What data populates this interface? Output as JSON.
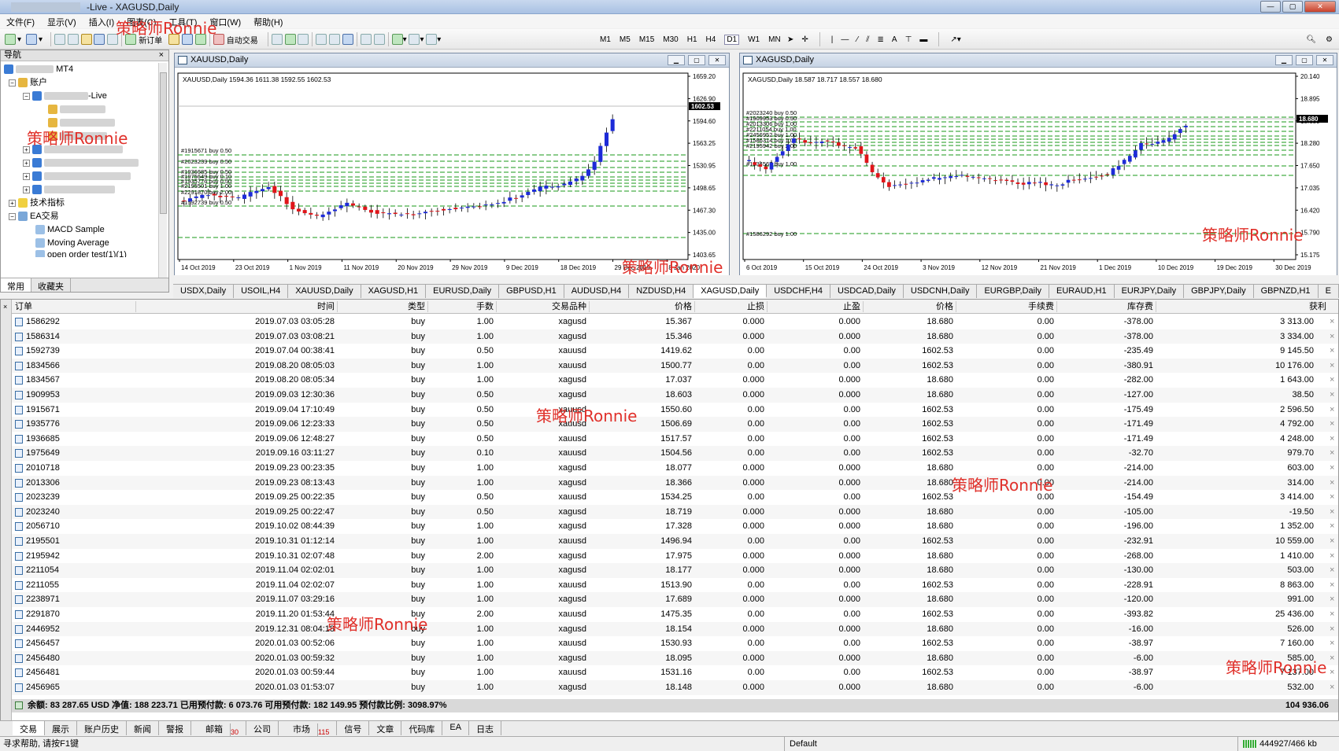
{
  "window": {
    "title": "-Live - XAGUSD,Daily"
  },
  "menu": [
    "文件(F)",
    "显示(V)",
    "插入(I)",
    "图表(C)",
    "工具(T)",
    "窗口(W)",
    "帮助(H)"
  ],
  "toolbar": {
    "new_order": "新订单",
    "auto_trade": "自动交易",
    "timeframes": [
      "M1",
      "M5",
      "M15",
      "M30",
      "H1",
      "H4",
      "D1",
      "W1",
      "MN"
    ]
  },
  "navigator": {
    "title": "导航",
    "items": [
      {
        "label": "MT4"
      },
      {
        "label": "账户"
      },
      {
        "label": "-Live"
      },
      {
        "label": "技术指标"
      },
      {
        "label": "EA交易"
      },
      {
        "label": "MACD Sample"
      },
      {
        "label": "Moving Average"
      },
      {
        "label": "open order test(1)(1)"
      }
    ],
    "tabs": [
      "常用",
      "收藏夹"
    ]
  },
  "chart1": {
    "title": "XAUUSD,Daily",
    "info": "XAUUSD,Daily  1594.36 1611.38 1592.55 1602.53",
    "price_labels": [
      "1659.20",
      "1626.90",
      "1594.60",
      "1563.25",
      "1530.95",
      "1498.65",
      "1467.30",
      "1435.00",
      "1403.65"
    ],
    "current_price": "1602.53",
    "dates": [
      "14 Oct 2019",
      "23 Oct 2019",
      "1 Nov 2019",
      "11 Nov 2019",
      "20 Nov 2019",
      "29 Nov 2019",
      "9 Dec 2019",
      "18 Dec 2019",
      "29 Dec 2019",
      "8 Jan 2020"
    ],
    "order_labels": [
      "#1915671 buy 0.50",
      "#2023239 buy 0.50",
      "#1936685 buy 0.50",
      "#1975649 buy 0.10",
      "#1935776 buy 0.50",
      "#2195501 buy 1.00",
      "#2291870 buy 2.00",
      "#1592739 buy 0.50"
    ]
  },
  "chart2": {
    "title": "XAGUSD,Daily",
    "info": "XAGUSD,Daily  18.587 18.717 18.557 18.680",
    "price_labels": [
      "20.140",
      "18.895",
      "18.680",
      "18.280",
      "17.650",
      "17.035",
      "16.420",
      "15.790",
      "15.175"
    ],
    "current_price": "18.680",
    "dates": [
      "6 Oct 2019",
      "15 Oct 2019",
      "24 Oct 2019",
      "3 Nov 2019",
      "12 Nov 2019",
      "21 Nov 2019",
      "1 Dec 2019",
      "10 Dec 2019",
      "19 Dec 2019",
      "30 Dec 2019"
    ],
    "order_labels": [
      "#2023240 buy 0.50",
      "#1909953 buy 0.50",
      "#2013306 buy 1.00",
      "#2211054 buy 1.00",
      "#2456952 buy 1.00",
      "#1586314 buy 1.00",
      "#2195942 buy 2.00",
      "#1834567 buy 1.00",
      "#1586292 buy 1.00"
    ]
  },
  "chart_tabs": [
    "USDX,Daily",
    "USOIL,H4",
    "XAUUSD,Daily",
    "XAGUSD,H1",
    "EURUSD,Daily",
    "GBPUSD,H1",
    "AUDUSD,H4",
    "NZDUSD,H4",
    "XAGUSD,Daily",
    "USDCHF,H4",
    "USDCAD,Daily",
    "USDCNH,Daily",
    "EURGBP,Daily",
    "EURAUD,H1",
    "EURJPY,Daily",
    "GBPJPY,Daily",
    "GBPNZD,H1",
    "E"
  ],
  "terminal": {
    "columns": [
      "订单",
      "时间",
      "类型",
      "手数",
      "交易品种",
      "价格",
      "止损",
      "止盈",
      "价格",
      "手续费",
      "库存费",
      "获利"
    ],
    "rows": [
      [
        "1586292",
        "2019.07.03 03:05:28",
        "buy",
        "1.00",
        "xagusd",
        "15.367",
        "0.000",
        "0.000",
        "18.680",
        "0.00",
        "-378.00",
        "3 313.00"
      ],
      [
        "1586314",
        "2019.07.03 03:08:21",
        "buy",
        "1.00",
        "xagusd",
        "15.346",
        "0.000",
        "0.000",
        "18.680",
        "0.00",
        "-378.00",
        "3 334.00"
      ],
      [
        "1592739",
        "2019.07.04 00:38:41",
        "buy",
        "0.50",
        "xauusd",
        "1419.62",
        "0.00",
        "0.00",
        "1602.53",
        "0.00",
        "-235.49",
        "9 145.50"
      ],
      [
        "1834566",
        "2019.08.20 08:05:03",
        "buy",
        "1.00",
        "xauusd",
        "1500.77",
        "0.00",
        "0.00",
        "1602.53",
        "0.00",
        "-380.91",
        "10 176.00"
      ],
      [
        "1834567",
        "2019.08.20 08:05:34",
        "buy",
        "1.00",
        "xagusd",
        "17.037",
        "0.000",
        "0.000",
        "18.680",
        "0.00",
        "-282.00",
        "1 643.00"
      ],
      [
        "1909953",
        "2019.09.03 12:30:36",
        "buy",
        "0.50",
        "xagusd",
        "18.603",
        "0.000",
        "0.000",
        "18.680",
        "0.00",
        "-127.00",
        "38.50"
      ],
      [
        "1915671",
        "2019.09.04 17:10:49",
        "buy",
        "0.50",
        "xauusd",
        "1550.60",
        "0.00",
        "0.00",
        "1602.53",
        "0.00",
        "-175.49",
        "2 596.50"
      ],
      [
        "1935776",
        "2019.09.06 12:23:33",
        "buy",
        "0.50",
        "xauusd",
        "1506.69",
        "0.00",
        "0.00",
        "1602.53",
        "0.00",
        "-171.49",
        "4 792.00"
      ],
      [
        "1936685",
        "2019.09.06 12:48:27",
        "buy",
        "0.50",
        "xauusd",
        "1517.57",
        "0.00",
        "0.00",
        "1602.53",
        "0.00",
        "-171.49",
        "4 248.00"
      ],
      [
        "1975649",
        "2019.09.16 03:11:27",
        "buy",
        "0.10",
        "xauusd",
        "1504.56",
        "0.00",
        "0.00",
        "1602.53",
        "0.00",
        "-32.70",
        "979.70"
      ],
      [
        "2010718",
        "2019.09.23 00:23:35",
        "buy",
        "1.00",
        "xagusd",
        "18.077",
        "0.000",
        "0.000",
        "18.680",
        "0.00",
        "-214.00",
        "603.00"
      ],
      [
        "2013306",
        "2019.09.23 08:13:43",
        "buy",
        "1.00",
        "xagusd",
        "18.366",
        "0.000",
        "0.000",
        "18.680",
        "0.00",
        "-214.00",
        "314.00"
      ],
      [
        "2023239",
        "2019.09.25 00:22:35",
        "buy",
        "0.50",
        "xauusd",
        "1534.25",
        "0.00",
        "0.00",
        "1602.53",
        "0.00",
        "-154.49",
        "3 414.00"
      ],
      [
        "2023240",
        "2019.09.25 00:22:47",
        "buy",
        "0.50",
        "xagusd",
        "18.719",
        "0.000",
        "0.000",
        "18.680",
        "0.00",
        "-105.00",
        "-19.50"
      ],
      [
        "2056710",
        "2019.10.02 08:44:39",
        "buy",
        "1.00",
        "xagusd",
        "17.328",
        "0.000",
        "0.000",
        "18.680",
        "0.00",
        "-196.00",
        "1 352.00"
      ],
      [
        "2195501",
        "2019.10.31 01:12:14",
        "buy",
        "1.00",
        "xauusd",
        "1496.94",
        "0.00",
        "0.00",
        "1602.53",
        "0.00",
        "-232.91",
        "10 559.00"
      ],
      [
        "2195942",
        "2019.10.31 02:07:48",
        "buy",
        "2.00",
        "xagusd",
        "17.975",
        "0.000",
        "0.000",
        "18.680",
        "0.00",
        "-268.00",
        "1 410.00"
      ],
      [
        "2211054",
        "2019.11.04 02:02:01",
        "buy",
        "1.00",
        "xagusd",
        "18.177",
        "0.000",
        "0.000",
        "18.680",
        "0.00",
        "-130.00",
        "503.00"
      ],
      [
        "2211055",
        "2019.11.04 02:02:07",
        "buy",
        "1.00",
        "xauusd",
        "1513.90",
        "0.00",
        "0.00",
        "1602.53",
        "0.00",
        "-228.91",
        "8 863.00"
      ],
      [
        "2238971",
        "2019.11.07 03:29:16",
        "buy",
        "1.00",
        "xagusd",
        "17.689",
        "0.000",
        "0.000",
        "18.680",
        "0.00",
        "-120.00",
        "991.00"
      ],
      [
        "2291870",
        "2019.11.20 01:53:44",
        "buy",
        "2.00",
        "xauusd",
        "1475.35",
        "0.00",
        "0.00",
        "1602.53",
        "0.00",
        "-393.82",
        "25 436.00"
      ],
      [
        "2446952",
        "2019.12.31 08:04:18",
        "buy",
        "1.00",
        "xagusd",
        "18.154",
        "0.000",
        "0.000",
        "18.680",
        "0.00",
        "-16.00",
        "526.00"
      ],
      [
        "2456457",
        "2020.01.03 00:52:06",
        "buy",
        "1.00",
        "xauusd",
        "1530.93",
        "0.00",
        "0.00",
        "1602.53",
        "0.00",
        "-38.97",
        "7 160.00"
      ],
      [
        "2456480",
        "2020.01.03 00:59:32",
        "buy",
        "1.00",
        "xagusd",
        "18.095",
        "0.000",
        "0.000",
        "18.680",
        "0.00",
        "-6.00",
        "585.00"
      ],
      [
        "2456481",
        "2020.01.03 00:59:44",
        "buy",
        "1.00",
        "xauusd",
        "1531.16",
        "0.00",
        "0.00",
        "1602.53",
        "0.00",
        "-38.97",
        "7 137.00"
      ],
      [
        "2456965",
        "2020.01.03 01:53:07",
        "buy",
        "1.00",
        "xagusd",
        "18.148",
        "0.000",
        "0.000",
        "18.680",
        "0.00",
        "-6.00",
        "532.00"
      ]
    ],
    "balance": "余额: 83 287.65 USD  净值: 188 223.71  已用预付款: 6 073.76  可用预付款: 182 149.95  预付款比例: 3098.97%",
    "total": "104 936.06",
    "tabs": [
      "交易",
      "展示",
      "账户历史",
      "新闻",
      "警报",
      "邮箱",
      "公司",
      "市场",
      "信号",
      "文章",
      "代码库",
      "EA",
      "日志"
    ],
    "mailbox_count": "30",
    "market_count": "115"
  },
  "status": {
    "help": "寻求帮助, 请按F1键",
    "profile": "Default",
    "traffic": "444927/466 kb"
  },
  "watermark": "策略师Ronnie"
}
